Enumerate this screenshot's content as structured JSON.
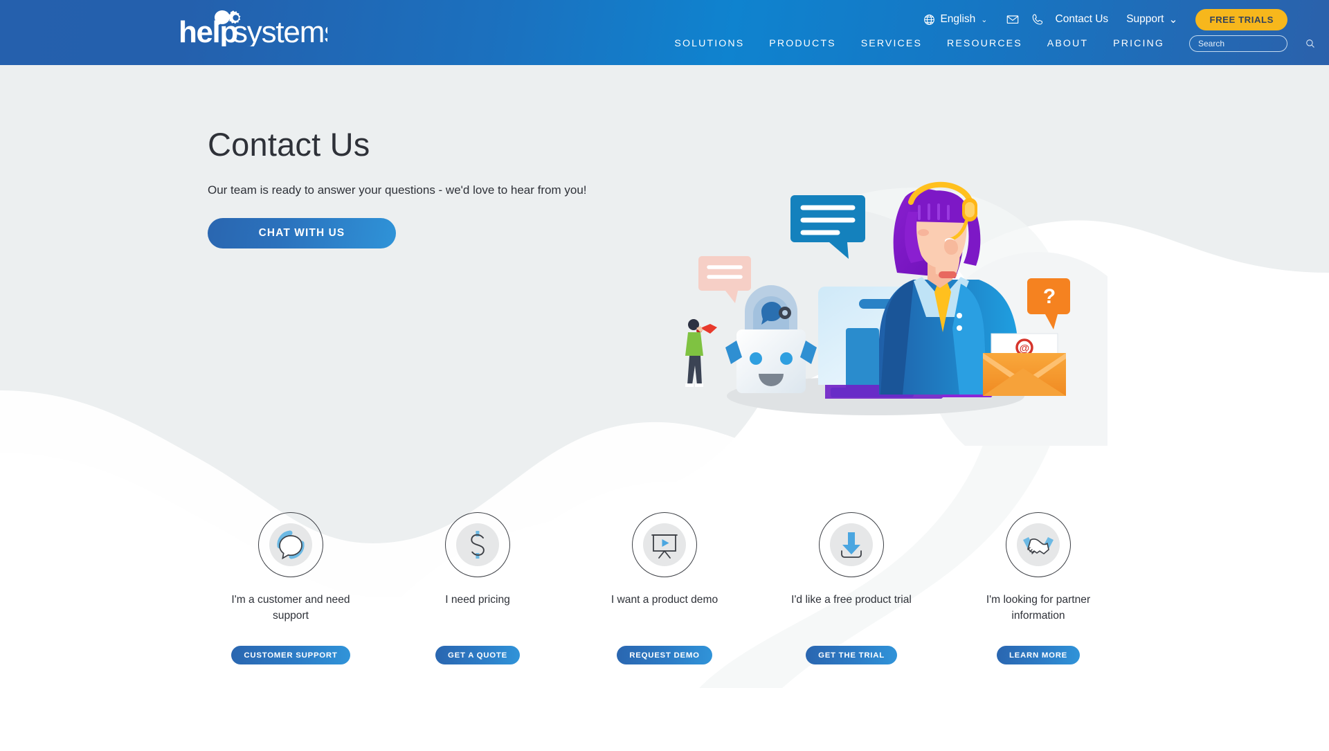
{
  "header": {
    "logo_text": "helpsystems",
    "logo_icon": "helpsystems-speech-gear-logo",
    "utility": {
      "language": "English",
      "language_icon": "globe-icon",
      "language_caret": "⌄",
      "email_icon": "envelope-icon",
      "phone_icon": "phone-icon",
      "contact_us": "Contact Us",
      "support": "Support",
      "support_caret": "⌄",
      "free_trials": "FREE TRIALS"
    },
    "nav": [
      {
        "label": "SOLUTIONS"
      },
      {
        "label": "PRODUCTS"
      },
      {
        "label": "SERVICES"
      },
      {
        "label": "RESOURCES"
      },
      {
        "label": "ABOUT"
      },
      {
        "label": "PRICING"
      }
    ],
    "search": {
      "placeholder": "Search",
      "value": "",
      "icon": "magnifier-icon"
    },
    "colors": {
      "bg_left": "#2560ad",
      "bg_mid": "#0f83cf",
      "bg_right": "#2b61ab",
      "free_trials_bg": "#f7b71c",
      "free_trials_text": "#34435b"
    }
  },
  "hero": {
    "title": "Contact Us",
    "subtitle": "Our team is ready to answer your questions - we'd love to hear from you!",
    "cta_label": "CHAT WITH US",
    "illustration_name": "customer-support-agent-illustration",
    "colors": {
      "bg": "#eceff0",
      "title": "#2e3138",
      "cta_from": "#2a66b0",
      "cta_to": "#2f93d8"
    }
  },
  "cards": [
    {
      "icon": "chat-support-icon",
      "label": "I'm a customer and need support",
      "button": "CUSTOMER SUPPORT"
    },
    {
      "icon": "dollar-pricing-icon",
      "label": "I need pricing",
      "button": "GET A QUOTE"
    },
    {
      "icon": "presentation-play-icon",
      "label": "I want a product demo",
      "button": "REQUEST DEMO"
    },
    {
      "icon": "download-arrow-icon",
      "label": "I'd like a free product trial",
      "button": "GET THE TRIAL"
    },
    {
      "icon": "handshake-icon",
      "label": "I'm looking for partner information",
      "button": "LEARN MORE"
    }
  ],
  "page": {
    "background": "#ffffff",
    "accent_blue": "#2f93d8",
    "text_dark": "#2e3138"
  }
}
